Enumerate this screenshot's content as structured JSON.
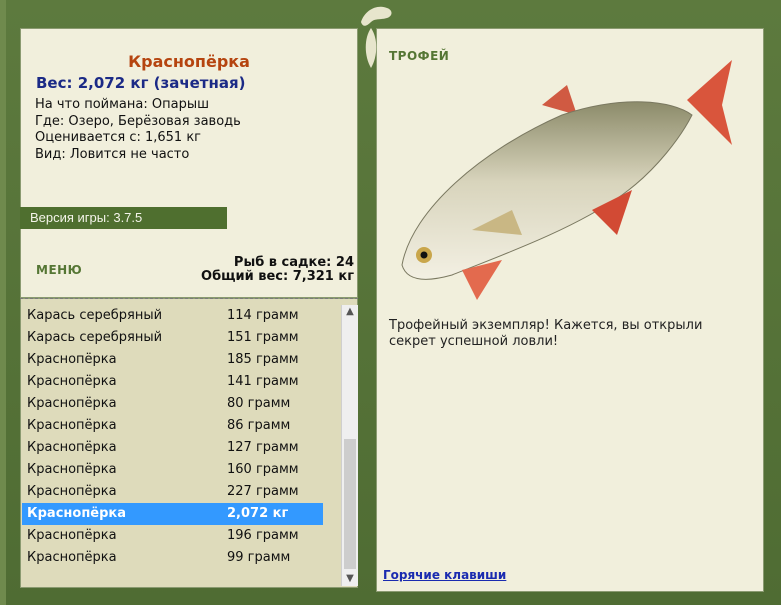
{
  "fish_card": {
    "name": "Краснопёрка",
    "weight": "Вес: 2,072 кг (зачетная)",
    "caught_on": "На что поймана: Опарыш",
    "location": "Где: Озеро, Берёзовая заводь",
    "valued_from": "Оценивается с: 1,651 кг",
    "kind": "Вид: Ловится не часто"
  },
  "version": "Версия игры: 3.7.5",
  "menu_label": "МЕНЮ",
  "stats": {
    "fish_in_keepnet": "Рыб в садке: 24",
    "total_weight": "Общий вес: 7,321 кг"
  },
  "catch_list": [
    {
      "name": "Карась серебряный",
      "weight": "114 грамм"
    },
    {
      "name": "Карась серебряный",
      "weight": "151 грамм"
    },
    {
      "name": "Краснопёрка",
      "weight": "185 грамм"
    },
    {
      "name": "Краснопёрка",
      "weight": "141 грамм"
    },
    {
      "name": "Краснопёрка",
      "weight": "80 грамм"
    },
    {
      "name": "Краснопёрка",
      "weight": "86 грамм"
    },
    {
      "name": "Краснопёрка",
      "weight": "127 грамм"
    },
    {
      "name": "Краснопёрка",
      "weight": "160 грамм"
    },
    {
      "name": "Краснопёрка",
      "weight": "227 грамм"
    },
    {
      "name": "Краснопёрка",
      "weight": "2,072 кг"
    },
    {
      "name": "Краснопёрка",
      "weight": "196 грамм"
    },
    {
      "name": "Краснопёрка",
      "weight": "99 грамм"
    }
  ],
  "trophy": {
    "label": "ТРОФЕЙ",
    "message": "Трофейный экземпляр! Кажется, вы открыли секрет успешной ловли!"
  },
  "hotkeys_label": "Горячие клавиши",
  "colors": {
    "frame": "#5d7a3e",
    "panel": "#f1efdc",
    "fish_name": "#b5440f",
    "weight": "#1b2a86",
    "selection": "#3399ff",
    "link": "#1a2bb0"
  },
  "icons": [
    "lizard-logo-icon",
    "leaf-ornament-icon",
    "scroll-up-icon",
    "scroll-down-icon"
  ]
}
